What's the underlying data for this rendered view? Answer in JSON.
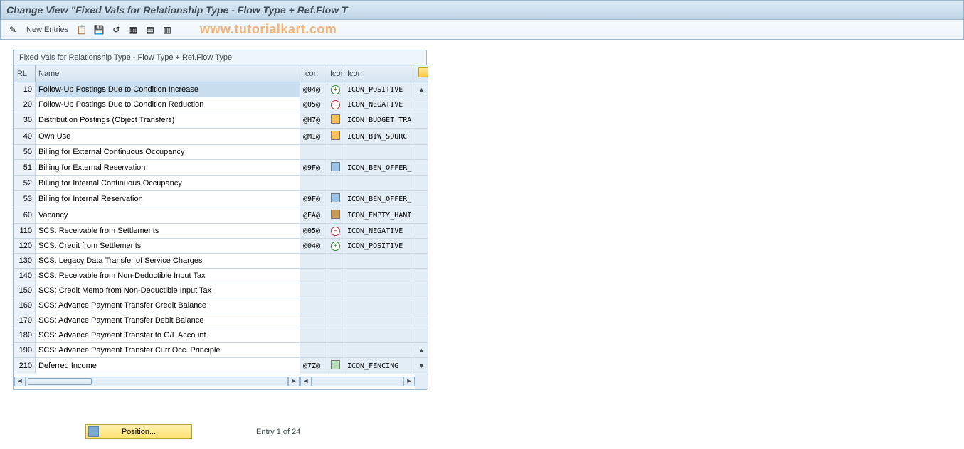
{
  "title": "Change View \"Fixed Vals for Relationship Type - Flow Type + Ref.Flow T",
  "watermark": "www.tutorialkart.com",
  "toolbar": {
    "new_entries": "New Entries"
  },
  "panel": {
    "caption": "Fixed Vals for Relationship Type - Flow Type + Ref.Flow Type",
    "headers": {
      "rl": "RL",
      "name": "Name",
      "icon1": "Icon",
      "icon2": "Icon",
      "icon3": "Icon"
    }
  },
  "rows": [
    {
      "rl": "10",
      "name": "Follow-Up Postings Due to Condition Increase",
      "code": "@04@",
      "sym": "plus",
      "iconname": "ICON_POSITIVE",
      "selected": true
    },
    {
      "rl": "20",
      "name": "Follow-Up Postings Due to Condition Reduction",
      "code": "@05@",
      "sym": "minus",
      "iconname": "ICON_NEGATIVE"
    },
    {
      "rl": "30",
      "name": "Distribution Postings (Object Transfers)",
      "code": "@H7@",
      "sym": "orange",
      "iconname": "ICON_BUDGET_TRA"
    },
    {
      "rl": "40",
      "name": "Own Use",
      "code": "@M1@",
      "sym": "orange",
      "iconname": "ICON_BIW_SOURC"
    },
    {
      "rl": "50",
      "name": "Billing for External Continuous Occupancy",
      "code": "",
      "sym": "",
      "iconname": ""
    },
    {
      "rl": "51",
      "name": "Billing for External Reservation",
      "code": "@9F@",
      "sym": "blue",
      "iconname": "ICON_BEN_OFFER_"
    },
    {
      "rl": "52",
      "name": "Billing for Internal Continuous Occupancy",
      "code": "",
      "sym": "",
      "iconname": ""
    },
    {
      "rl": "53",
      "name": "Billing for Internal Reservation",
      "code": "@9F@",
      "sym": "blue",
      "iconname": "ICON_BEN_OFFER_"
    },
    {
      "rl": "60",
      "name": "Vacancy",
      "code": "@EA@",
      "sym": "brown",
      "iconname": "ICON_EMPTY_HANI"
    },
    {
      "rl": "110",
      "name": "SCS: Receivable from Settlements",
      "code": "@05@",
      "sym": "minus",
      "iconname": "ICON_NEGATIVE"
    },
    {
      "rl": "120",
      "name": "SCS: Credit from Settlements",
      "code": "@04@",
      "sym": "plus",
      "iconname": "ICON_POSITIVE"
    },
    {
      "rl": "130",
      "name": "SCS: Legacy Data Transfer of Service Charges",
      "code": "",
      "sym": "",
      "iconname": ""
    },
    {
      "rl": "140",
      "name": "SCS: Receivable from Non-Deductible Input Tax",
      "code": "",
      "sym": "",
      "iconname": ""
    },
    {
      "rl": "150",
      "name": "SCS: Credit Memo from Non-Deductible Input Tax",
      "code": "",
      "sym": "",
      "iconname": ""
    },
    {
      "rl": "160",
      "name": "SCS: Advance Payment Transfer Credit Balance",
      "code": "",
      "sym": "",
      "iconname": ""
    },
    {
      "rl": "170",
      "name": "SCS: Advance Payment Transfer Debit Balance",
      "code": "",
      "sym": "",
      "iconname": ""
    },
    {
      "rl": "180",
      "name": "SCS: Advance Payment Transfer to G/L Account",
      "code": "",
      "sym": "",
      "iconname": ""
    },
    {
      "rl": "190",
      "name": "SCS: Advance Payment Transfer Curr.Occ. Principle",
      "code": "",
      "sym": "",
      "iconname": ""
    },
    {
      "rl": "210",
      "name": "Deferred Income",
      "code": "@7Z@",
      "sym": "fence",
      "iconname": "ICON_FENCING"
    }
  ],
  "footer": {
    "position_btn": "Position...",
    "status": "Entry 1 of 24"
  }
}
